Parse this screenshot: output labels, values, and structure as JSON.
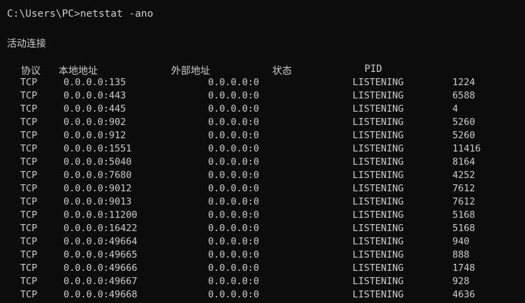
{
  "terminal": {
    "prompt": "C:\\Users\\PC>netstat -ano",
    "heading": "活动连接",
    "columns": {
      "proto": "协议",
      "local": "本地地址",
      "foreign": "外部地址",
      "state": "状态",
      "pid": "PID"
    },
    "rows": [
      {
        "proto": "TCP",
        "local": "0.0.0.0:135",
        "foreign": "0.0.0.0:0",
        "state": "LISTENING",
        "pid": "1224"
      },
      {
        "proto": "TCP",
        "local": "0.0.0.0:443",
        "foreign": "0.0.0.0:0",
        "state": "LISTENING",
        "pid": "6588"
      },
      {
        "proto": "TCP",
        "local": "0.0.0.0:445",
        "foreign": "0.0.0.0:0",
        "state": "LISTENING",
        "pid": "4"
      },
      {
        "proto": "TCP",
        "local": "0.0.0.0:902",
        "foreign": "0.0.0.0:0",
        "state": "LISTENING",
        "pid": "5260"
      },
      {
        "proto": "TCP",
        "local": "0.0.0.0:912",
        "foreign": "0.0.0.0:0",
        "state": "LISTENING",
        "pid": "5260"
      },
      {
        "proto": "TCP",
        "local": "0.0.0.0:1551",
        "foreign": "0.0.0.0:0",
        "state": "LISTENING",
        "pid": "11416"
      },
      {
        "proto": "TCP",
        "local": "0.0.0.0:5040",
        "foreign": "0.0.0.0:0",
        "state": "LISTENING",
        "pid": "8164"
      },
      {
        "proto": "TCP",
        "local": "0.0.0.0:7680",
        "foreign": "0.0.0.0:0",
        "state": "LISTENING",
        "pid": "4252"
      },
      {
        "proto": "TCP",
        "local": "0.0.0.0:9012",
        "foreign": "0.0.0.0:0",
        "state": "LISTENING",
        "pid": "7612"
      },
      {
        "proto": "TCP",
        "local": "0.0.0.0:9013",
        "foreign": "0.0.0.0:0",
        "state": "LISTENING",
        "pid": "7612"
      },
      {
        "proto": "TCP",
        "local": "0.0.0.0:11200",
        "foreign": "0.0.0.0:0",
        "state": "LISTENING",
        "pid": "5168"
      },
      {
        "proto": "TCP",
        "local": "0.0.0.0:16422",
        "foreign": "0.0.0.0:0",
        "state": "LISTENING",
        "pid": "5168"
      },
      {
        "proto": "TCP",
        "local": "0.0.0.0:49664",
        "foreign": "0.0.0.0:0",
        "state": "LISTENING",
        "pid": "940"
      },
      {
        "proto": "TCP",
        "local": "0.0.0.0:49665",
        "foreign": "0.0.0.0:0",
        "state": "LISTENING",
        "pid": "888"
      },
      {
        "proto": "TCP",
        "local": "0.0.0.0:49666",
        "foreign": "0.0.0.0:0",
        "state": "LISTENING",
        "pid": "1748"
      },
      {
        "proto": "TCP",
        "local": "0.0.0.0:49667",
        "foreign": "0.0.0.0:0",
        "state": "LISTENING",
        "pid": "928"
      },
      {
        "proto": "TCP",
        "local": "0.0.0.0:49668",
        "foreign": "0.0.0.0:0",
        "state": "LISTENING",
        "pid": "4636"
      }
    ]
  },
  "colors": {
    "background": "#0c0c0c",
    "text": "#cccccc"
  }
}
